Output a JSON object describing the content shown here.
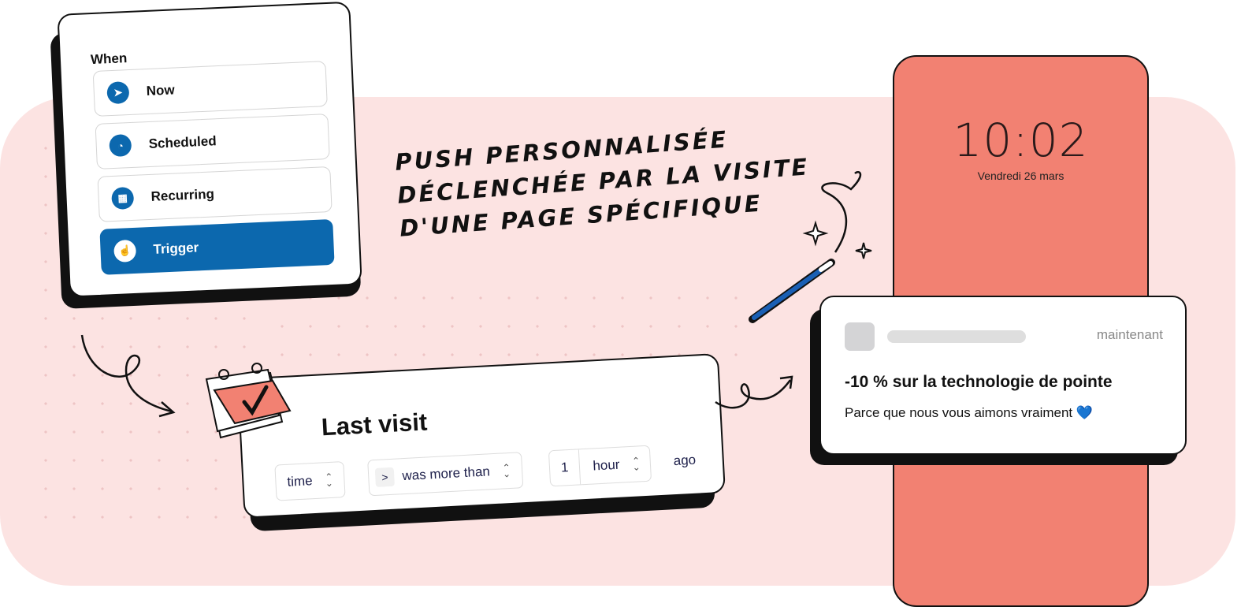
{
  "when_card": {
    "title": "When",
    "options": [
      {
        "label": "Now",
        "icon": "send-now-icon",
        "selected": false
      },
      {
        "label": "Scheduled",
        "icon": "clock-icon",
        "selected": false
      },
      {
        "label": "Recurring",
        "icon": "calendar-icon",
        "selected": false
      },
      {
        "label": "Trigger",
        "icon": "hand-pointer-icon",
        "selected": true
      }
    ]
  },
  "headline": [
    "Push personnalisée",
    "déclenchée par la visite",
    "d'une page spécifique"
  ],
  "last_visit": {
    "title": "Last visit",
    "field": "time",
    "operator_prefix": ">",
    "operator": "was more than",
    "amount": "1",
    "unit": "hour",
    "suffix": "ago"
  },
  "phone": {
    "time": "10:02",
    "date": "Vendredi 26 mars"
  },
  "notification": {
    "time": "maintenant",
    "title": "-10 % sur la technologie de pointe",
    "body": "Parce que nous vous aimons vraiment 💙"
  },
  "colors": {
    "accent": "#0c68ae",
    "background": "#fce3e2",
    "phone": "#f28172"
  }
}
